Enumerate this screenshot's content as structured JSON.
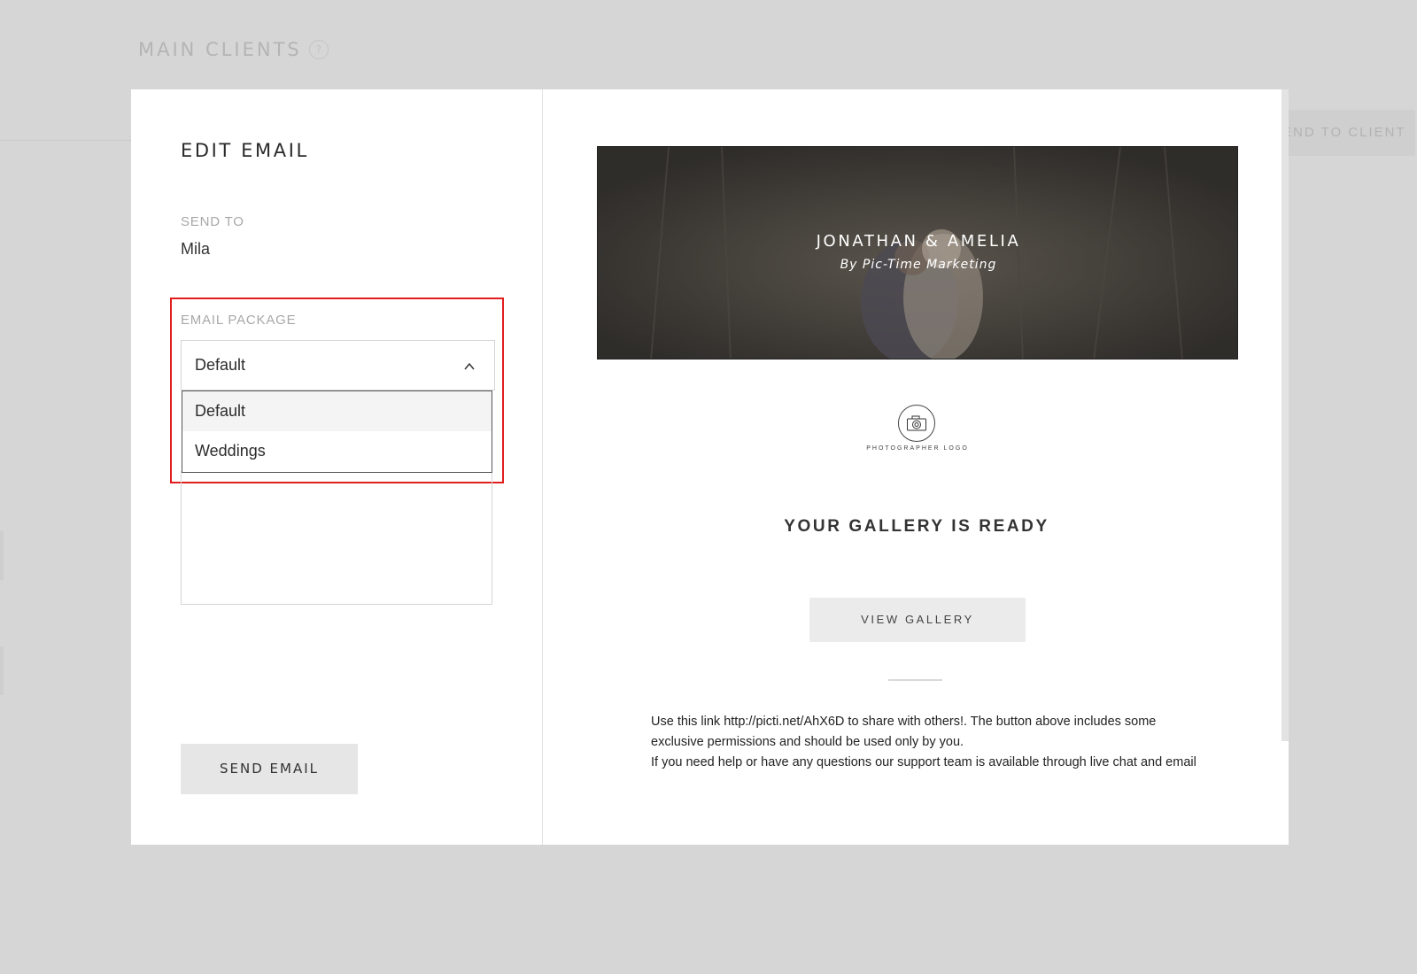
{
  "background": {
    "page_title": "MAIN CLIENTS",
    "help_icon": "question-circle-icon",
    "send_to_client_label": "SEND TO CLIENT"
  },
  "modal": {
    "title": "EDIT EMAIL",
    "send_to": {
      "label": "SEND TO",
      "value": "Mila"
    },
    "email_package": {
      "label": "EMAIL PACKAGE",
      "selected": "Default",
      "expanded": true,
      "chevron_icon": "chevron-up-icon",
      "options": [
        "Default",
        "Weddings"
      ]
    },
    "send_button_label": "SEND EMAIL"
  },
  "preview": {
    "hero_title": "JONATHAN & AMELIA",
    "hero_subtitle": "By Pic-Time Marketing",
    "logo_icon": "camera-icon",
    "logo_text": "PHOTOGRAPHER LOGO",
    "heading": "YOUR GALLERY IS READY",
    "view_gallery_label": "VIEW GALLERY",
    "body_line_1": "Use this link http://picti.net/AhX6D to share with others!. The button above includes some exclusive permissions and should be used only by you.",
    "body_line_2": "If you need help or have any questions our support team is available through live chat and email"
  },
  "colors": {
    "overlay_background": "#d6d6d6",
    "highlight_border": "#e21d1d",
    "button_gray": "#e6e6e6",
    "hero_background": "#3a3834"
  }
}
